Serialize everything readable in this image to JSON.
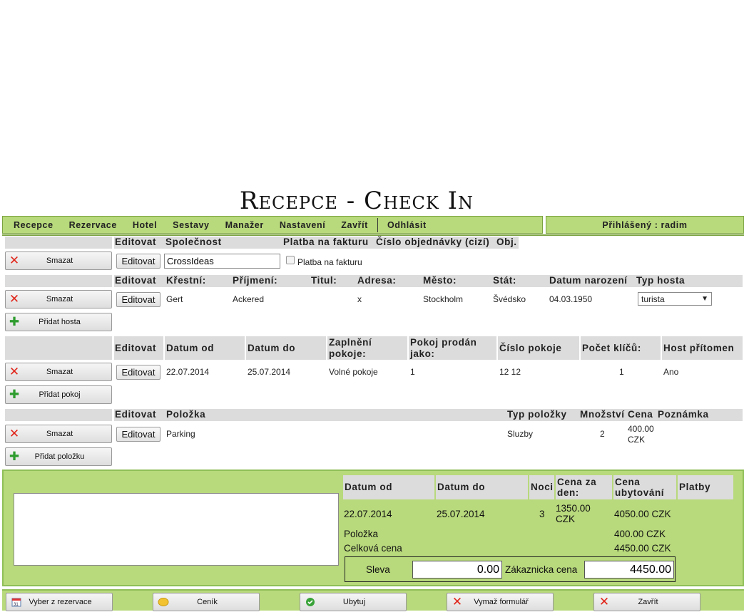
{
  "page": {
    "title": "Recepce - Check In"
  },
  "menu": {
    "items": [
      "Recepce",
      "Rezervace",
      "Hotel",
      "Sestavy",
      "Manažer",
      "Nastavení",
      "Zavřít"
    ],
    "logout": "Odhlásit",
    "logged_in": "Přihlášený : radim"
  },
  "company": {
    "headers": [
      "Editovat",
      "Společnost",
      "Platba na fakturu",
      "Číslo objednávky (cizí)",
      "Obj."
    ],
    "delete_label": "Smazat",
    "edit_label": "Editovat",
    "name_value": "CrossIdeas",
    "invoice_label": "Platba na fakturu"
  },
  "guests": {
    "headers": [
      "Editovat",
      "Křestní:",
      "Příjmení:",
      "Titul:",
      "Adresa:",
      "Město:",
      "Stát:",
      "Datum narození",
      "Typ hosta"
    ],
    "delete_label": "Smazat",
    "edit_label": "Editovat",
    "add_label": "Přidat hosta",
    "row": {
      "first": "Gert",
      "last": "Ackered",
      "title": "",
      "address": "x",
      "city": "Stockholm",
      "country": "Švédsko",
      "birth": "04.03.1950",
      "type": "turista"
    }
  },
  "rooms": {
    "headers": [
      "Editovat",
      "Datum od",
      "Datum do",
      "Zaplnění pokoje:",
      "Pokoj prodán jako:",
      "Číslo pokoje",
      "Počet klíčů:",
      "Host přítomen"
    ],
    "delete_label": "Smazat",
    "edit_label": "Editovat",
    "add_label": "Přidat pokoj",
    "row": {
      "from": "22.07.2014",
      "to": "25.07.2014",
      "occupancy": "Volné pokoje",
      "sold_as": "1",
      "room_no": "12 12",
      "keys": "1",
      "present": "Ano"
    }
  },
  "items": {
    "headers": [
      "Editovat",
      "Položka",
      "Typ položky",
      "Množství",
      "Cena",
      "Poznámka"
    ],
    "delete_label": "Smazat",
    "edit_label": "Editovat",
    "add_label": "Přidat položku",
    "row": {
      "name": "Parking",
      "type": "Sluzby",
      "qty": "2",
      "price": "400.00 CZK",
      "note": ""
    }
  },
  "summary": {
    "headers": [
      "Datum od",
      "Datum do",
      "Noci",
      "Cena za den:",
      "Cena ubytování",
      "Platby"
    ],
    "row": {
      "from": "22.07.2014",
      "to": "25.07.2014",
      "nights": "3",
      "per_day": "1350.00 CZK",
      "lodging": "4050.00 CZK",
      "payments": ""
    },
    "item_label": "Položka",
    "item_value": "400.00 CZK",
    "total_label": "Celková cena",
    "total_value": "4450.00 CZK",
    "discount_label": "Sleva",
    "discount_value": "0.00",
    "customer_price_label": "Zákaznicka cena",
    "customer_price_value": "4450.00"
  },
  "bottom": {
    "buttons": [
      "Vyber z rezervace",
      "Ceník",
      "Ubytuj",
      "Vymaž formulář",
      "Zavřít"
    ]
  },
  "colors": {
    "accent_green": "#b8d97c",
    "border_green": "#7aa33f",
    "delete_red": "#e0261b",
    "add_green": "#2e9c2e"
  }
}
